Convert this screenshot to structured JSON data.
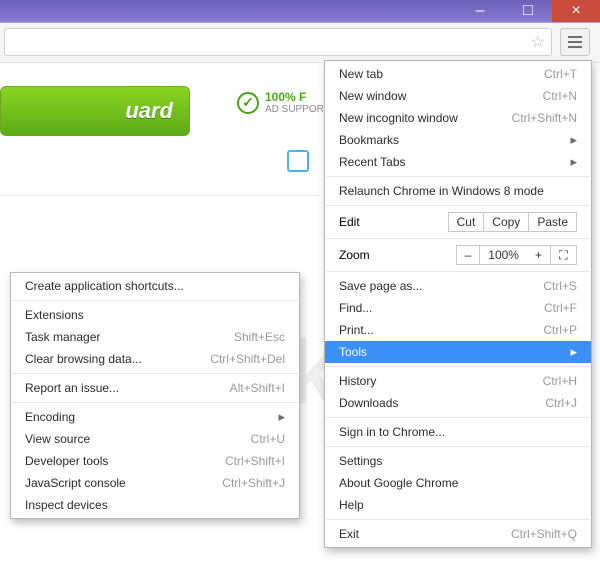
{
  "window": {
    "minimize": "–",
    "maximize": "□",
    "close": "×"
  },
  "toolbar": {
    "star": "☆"
  },
  "page": {
    "greenButton": "uard",
    "free": {
      "top": "100% F",
      "bottom": "AD SUPPOR"
    },
    "watermark": "PCrisk.com"
  },
  "menu": {
    "newTab": {
      "label": "New tab",
      "shortcut": "Ctrl+T"
    },
    "newWindow": {
      "label": "New window",
      "shortcut": "Ctrl+N"
    },
    "incognito": {
      "label": "New incognito window",
      "shortcut": "Ctrl+Shift+N"
    },
    "bookmarks": {
      "label": "Bookmarks"
    },
    "recentTabs": {
      "label": "Recent Tabs"
    },
    "relaunch": {
      "label": "Relaunch Chrome in Windows 8 mode"
    },
    "edit": {
      "label": "Edit",
      "cut": "Cut",
      "copy": "Copy",
      "paste": "Paste"
    },
    "zoom": {
      "label": "Zoom",
      "minus": "–",
      "value": "100%",
      "plus": "+"
    },
    "save": {
      "label": "Save page as...",
      "shortcut": "Ctrl+S"
    },
    "find": {
      "label": "Find...",
      "shortcut": "Ctrl+F"
    },
    "print": {
      "label": "Print...",
      "shortcut": "Ctrl+P"
    },
    "tools": {
      "label": "Tools"
    },
    "history": {
      "label": "History",
      "shortcut": "Ctrl+H"
    },
    "downloads": {
      "label": "Downloads",
      "shortcut": "Ctrl+J"
    },
    "signin": {
      "label": "Sign in to Chrome..."
    },
    "settings": {
      "label": "Settings"
    },
    "about": {
      "label": "About Google Chrome"
    },
    "help": {
      "label": "Help"
    },
    "exit": {
      "label": "Exit",
      "shortcut": "Ctrl+Shift+Q"
    }
  },
  "submenu": {
    "createShortcuts": {
      "label": "Create application shortcuts..."
    },
    "extensions": {
      "label": "Extensions"
    },
    "taskManager": {
      "label": "Task manager",
      "shortcut": "Shift+Esc"
    },
    "clearData": {
      "label": "Clear browsing data...",
      "shortcut": "Ctrl+Shift+Del"
    },
    "report": {
      "label": "Report an issue...",
      "shortcut": "Alt+Shift+I"
    },
    "encoding": {
      "label": "Encoding"
    },
    "viewSource": {
      "label": "View source",
      "shortcut": "Ctrl+U"
    },
    "devTools": {
      "label": "Developer tools",
      "shortcut": "Ctrl+Shift+I"
    },
    "jsConsole": {
      "label": "JavaScript console",
      "shortcut": "Ctrl+Shift+J"
    },
    "inspect": {
      "label": "Inspect devices"
    }
  }
}
